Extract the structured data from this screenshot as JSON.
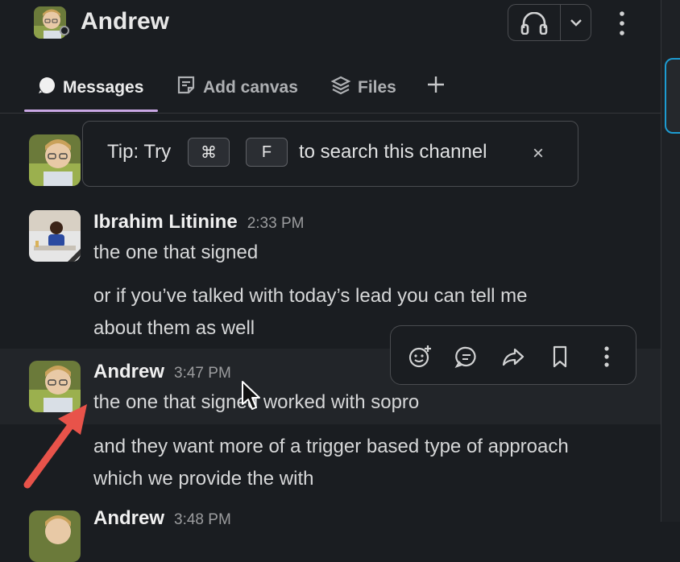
{
  "header": {
    "title": "Andrew",
    "kebab": "⋮"
  },
  "tabs": [
    {
      "label": "Messages",
      "icon": "message-bubble-icon"
    },
    {
      "label": "Add canvas",
      "icon": "canvas-icon"
    },
    {
      "label": "Files",
      "icon": "layers-icon"
    }
  ],
  "tip": {
    "prefix": "Tip: Try",
    "key1": "⌘",
    "key2": "F",
    "suffix": "to search this channel",
    "close": "×"
  },
  "messages": [
    {
      "author": "Ibrahim Litinine",
      "time": "2:33 PM",
      "lines": [
        "the one that signed",
        "or if you’ve talked with today’s lead you can tell me",
        "about them as well"
      ]
    },
    {
      "author": "Andrew",
      "time": "3:47 PM",
      "lines": [
        "the one that signed worked with sopro",
        "and they want more of a trigger based type of approach",
        "which we provide the with"
      ]
    },
    {
      "author": "Andrew",
      "time": "3:48 PM",
      "lines": []
    }
  ],
  "colors": {
    "background": "#1a1d21",
    "accent_tab": "#c9a7e4",
    "arrow": "#e8534a",
    "rail_accent": "#1d9bd1"
  }
}
